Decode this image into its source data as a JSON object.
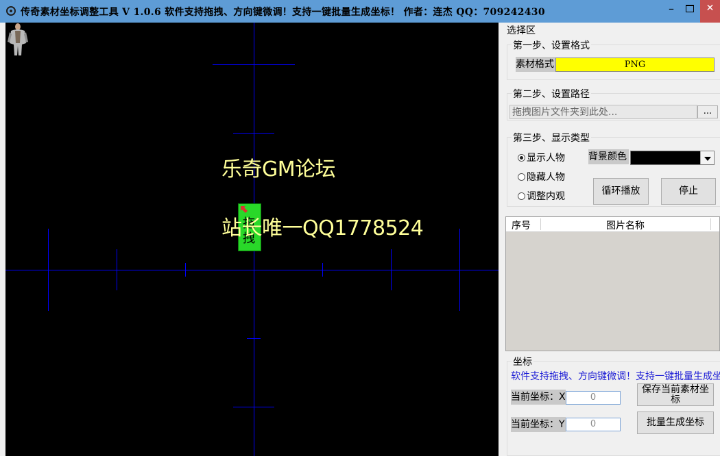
{
  "window": {
    "title": "传奇素材坐标调整工具 V 1.0.6  软件支持拖拽、方向键微调！支持一键批量生成坐标！ 作者：连杰 QQ：709242430",
    "minimize_glyph": "–",
    "close_glyph": "✕"
  },
  "canvas": {
    "background": "#000000",
    "guide_color": "#0000ff",
    "watermark_line1": "乐奇GM论坛",
    "watermark_line2": "站长唯一QQ1778524",
    "drag_handle_text_1": "拖",
    "drag_handle_text_2": "拽"
  },
  "panel": {
    "section_title": "选择区",
    "step1": {
      "title": "第一步、设置格式",
      "format_label": "素材格式",
      "format_value": "PNG"
    },
    "step2": {
      "title": "第二步、设置路径",
      "path_placeholder": "拖拽图片文件夹到此处...",
      "browse_label": "..."
    },
    "step3": {
      "title": "第三步、显示类型",
      "options": [
        "显示人物",
        "隐藏人物",
        "调整内观"
      ],
      "selected_option": "显示人物",
      "bg_color_label": "背景颜色",
      "bg_color_value": "#000000",
      "loop_play_label": "循环播放",
      "stop_label": "停止"
    },
    "list": {
      "columns": [
        "序号",
        "图片名称"
      ],
      "rows": []
    },
    "coords": {
      "title": "坐标",
      "notice": "软件支持拖拽、方向键微调！支持一键批量生成坐标！",
      "x_label": "当前坐标：X",
      "x_value": "0",
      "y_label": "当前坐标：Y",
      "y_value": "0",
      "save_label": "保存当前素材坐标",
      "batch_label": "批量生成坐标"
    }
  }
}
